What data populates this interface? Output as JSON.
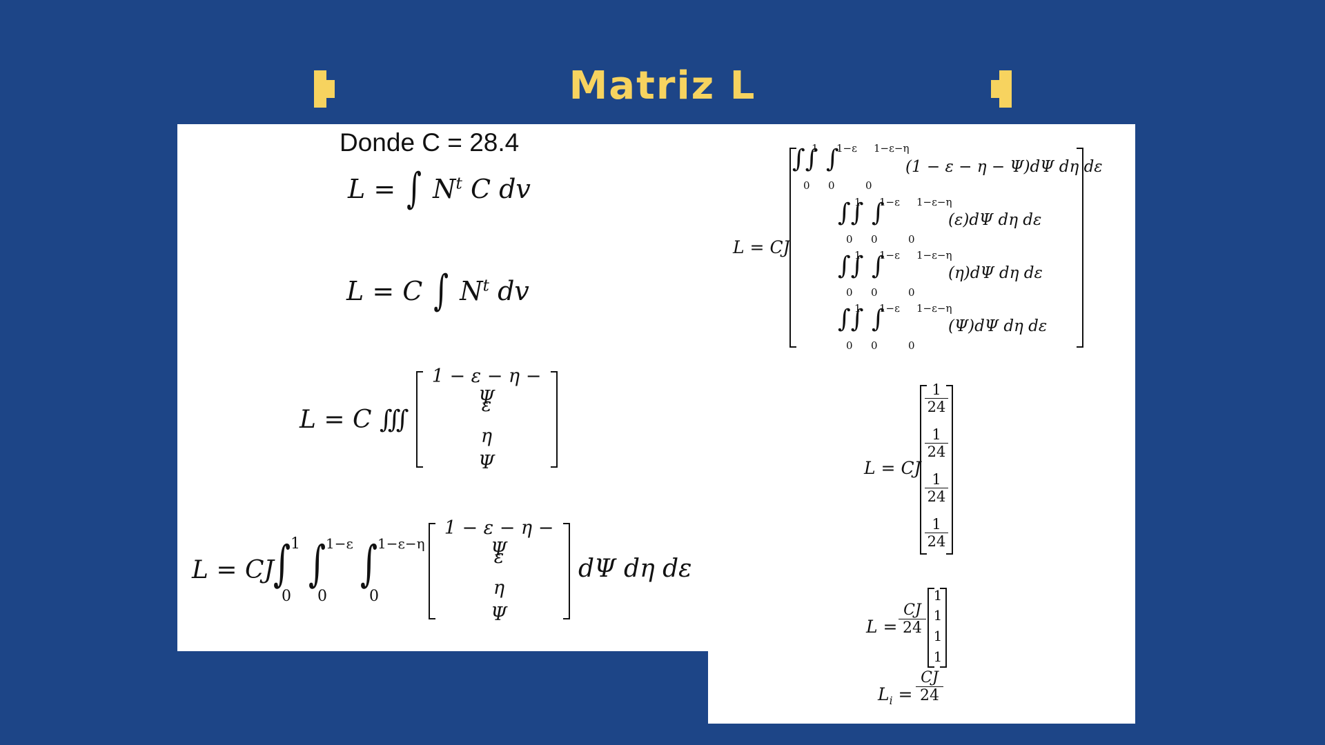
{
  "title": "Matriz L",
  "colors": {
    "background": "#1d4587",
    "accent": "#f7d35f",
    "panel": "#ffffff"
  },
  "left": {
    "donde": "Donde C = 28.4",
    "eq1": {
      "lhs": "L =",
      "rhs_a": "N",
      "rhs_sup": "t",
      "rhs_b": "C dv"
    },
    "eq2": {
      "lhs": "L = C",
      "rhs_a": "N",
      "rhs_sup": "t",
      "rhs_b": "dv"
    },
    "eq3": {
      "lhs": "L = C ∭",
      "vector": [
        "1 − ε − η − Ψ",
        "ε",
        "η",
        "Ψ"
      ]
    },
    "eq4": {
      "lhs": "L = CJ",
      "limits": [
        [
          "1",
          "0"
        ],
        [
          "1−ε",
          "0"
        ],
        [
          "1−ε−η",
          "0"
        ]
      ],
      "vector": [
        "1 − ε − η − Ψ",
        "ε",
        "η",
        "Ψ"
      ],
      "tail": "dΨ dη dε"
    }
  },
  "right": {
    "eq5": {
      "lhs": "L = CJ",
      "limits": [
        [
          "1",
          "0"
        ],
        [
          "1−ε",
          "0"
        ],
        [
          "1−ε−η",
          "0"
        ]
      ],
      "rows": [
        "(1 − ε − η − Ψ)dΨ dη dε",
        "(ε)dΨ dη dε",
        "(η)dΨ dη dε",
        "(Ψ)dΨ dη dε"
      ]
    },
    "eq6": {
      "lhs": "L = CJ",
      "fractions": [
        {
          "num": "1",
          "den": "24"
        },
        {
          "num": "1",
          "den": "24"
        },
        {
          "num": "1",
          "den": "24"
        },
        {
          "num": "1",
          "den": "24"
        }
      ]
    },
    "eq7": {
      "lhs": "L =",
      "num": "CJ",
      "den": "24",
      "vector": [
        "1",
        "1",
        "1",
        "1"
      ]
    },
    "eq8": {
      "lhs": "L",
      "sub": "i",
      "eq": "=",
      "num": "CJ",
      "den": "24"
    }
  }
}
